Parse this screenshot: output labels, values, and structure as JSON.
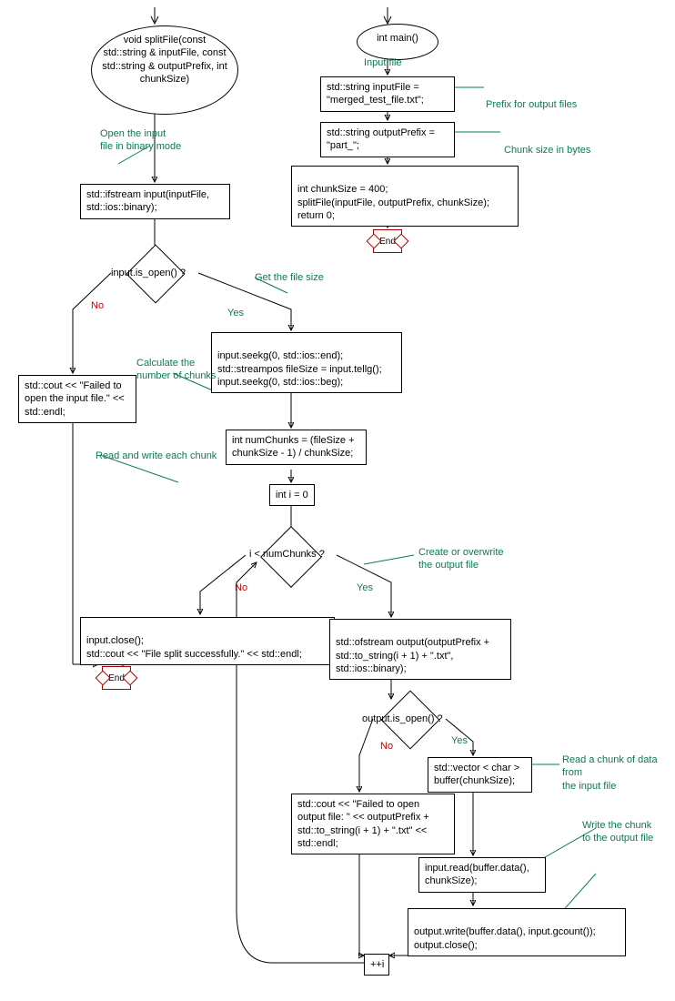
{
  "func": {
    "signature": "void splitFile(const std::string & inputFile, const std::string & outputPrefix, int chunkSize)",
    "open_comment": "Open the input file in binary mode",
    "ifstream": "std::ifstream input(inputFile, std::ios::binary);",
    "is_open": "input.is_open() ?",
    "yes": "Yes",
    "no": "No",
    "fail_open": "std::cout << \"Failed to open the input file.\" << std::endl;",
    "get_size_comment": "Get the file size",
    "seek": "input.seekg(0, std::ios::end);\nstd::streampos fileSize = input.tellg();\ninput.seekg(0, std::ios::beg);",
    "calc_comment": "Calculate the number of chunks",
    "numchunks": "int numChunks = (fileSize + chunkSize - 1) / chunkSize;",
    "rw_comment": "Read and write each chunk",
    "init_i": "int i = 0",
    "loop_cond": "i < numChunks ?",
    "close_success": "input.close();\nstd::cout << \"File split successfully.\" << std::endl;",
    "create_comment": "Create or overwrite the output file",
    "ofstream": "std::ofstream output(outputPrefix + std::to_string(i + 1) + \".txt\",\nstd::ios::binary);",
    "out_is_open": "output.is_open() ?",
    "buffer": "std::vector < char > buffer(chunkSize);",
    "read_comment": "Read a chunk of data from the input file",
    "fail_out": "std::cout << \"Failed to open output file: \" << outputPrefix + std::to_string(i + 1) + \".txt\" << std::endl;",
    "read": "input.read(buffer.data(), chunkSize);",
    "write_comment": "Write the chunk to the output file",
    "write": "output.write(buffer.data(), input.gcount());\noutput.close();",
    "inc": "++i",
    "end": "End"
  },
  "main": {
    "signature": "int main()",
    "input_comment": "Input file",
    "inputfile": "std::string inputFile = \"merged_test_file.txt\";",
    "prefix_comment": "Prefix for output files",
    "prefix": "std::string outputPrefix = \"part_\";",
    "chunk_comment": "Chunk size in bytes",
    "chunk": "int chunkSize = 400;\nsplitFile(inputFile, outputPrefix, chunkSize);\nreturn 0;",
    "end": "End"
  }
}
